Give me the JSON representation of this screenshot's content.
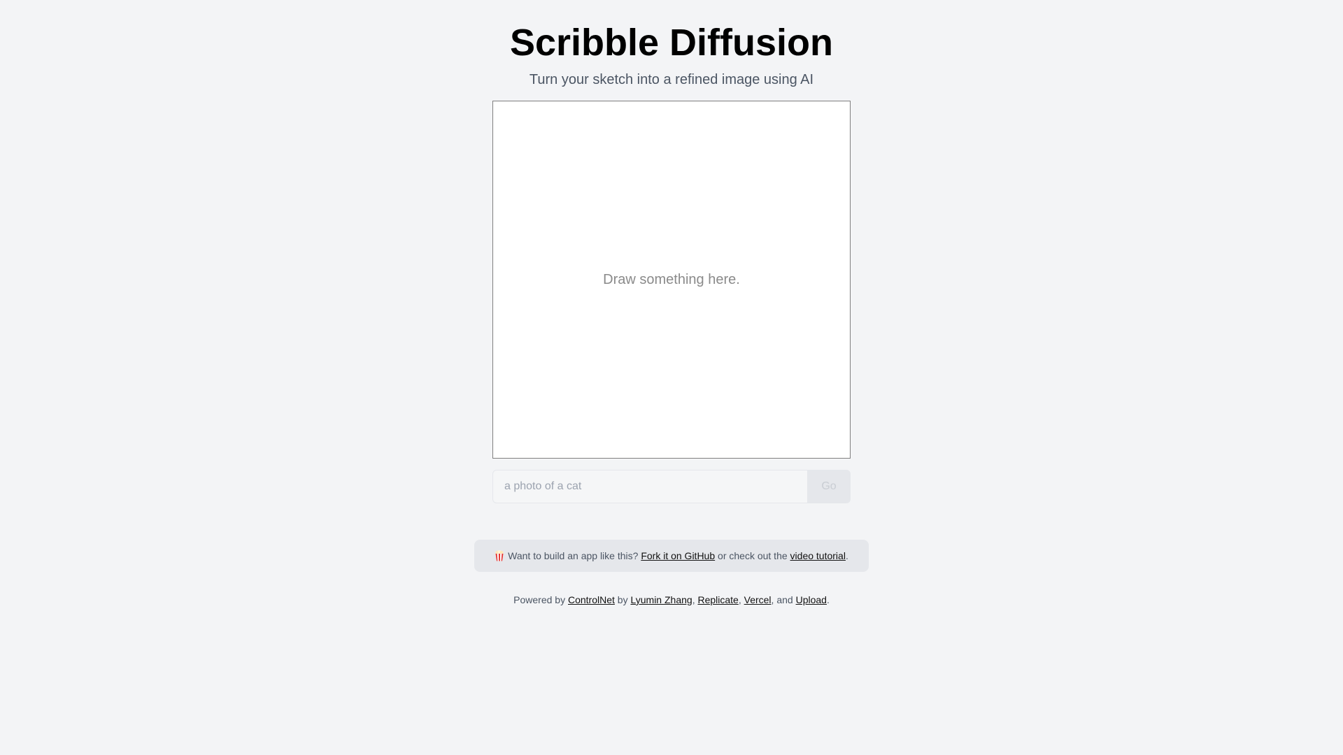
{
  "header": {
    "title": "Scribble Diffusion",
    "subtitle": "Turn your sketch into a refined image using AI"
  },
  "canvas": {
    "hint": "Draw something here."
  },
  "prompt": {
    "placeholder": "a photo of a cat",
    "value": "",
    "submit_label": "Go"
  },
  "promo": {
    "icon": "popcorn-icon",
    "lead": "Want to build an app like this?",
    "github_link": "Fork it on GitHub",
    "middle": "or check out the",
    "tutorial_link": "video tutorial",
    "end": "."
  },
  "footer": {
    "powered_by": "Powered by",
    "controlnet_link": "ControlNet",
    "by": "by",
    "author_link": "Lyumin Zhang",
    "sep1": ",",
    "replicate_link": "Replicate",
    "sep2": ",",
    "vercel_link": "Vercel",
    "and": ", and",
    "upload_link": "Upload",
    "end": "."
  },
  "colors": {
    "background": "#f3f4f6",
    "promo_background": "#e5e7eb",
    "button_background": "#e5e7eb",
    "button_text_disabled": "#c9cdd3"
  }
}
